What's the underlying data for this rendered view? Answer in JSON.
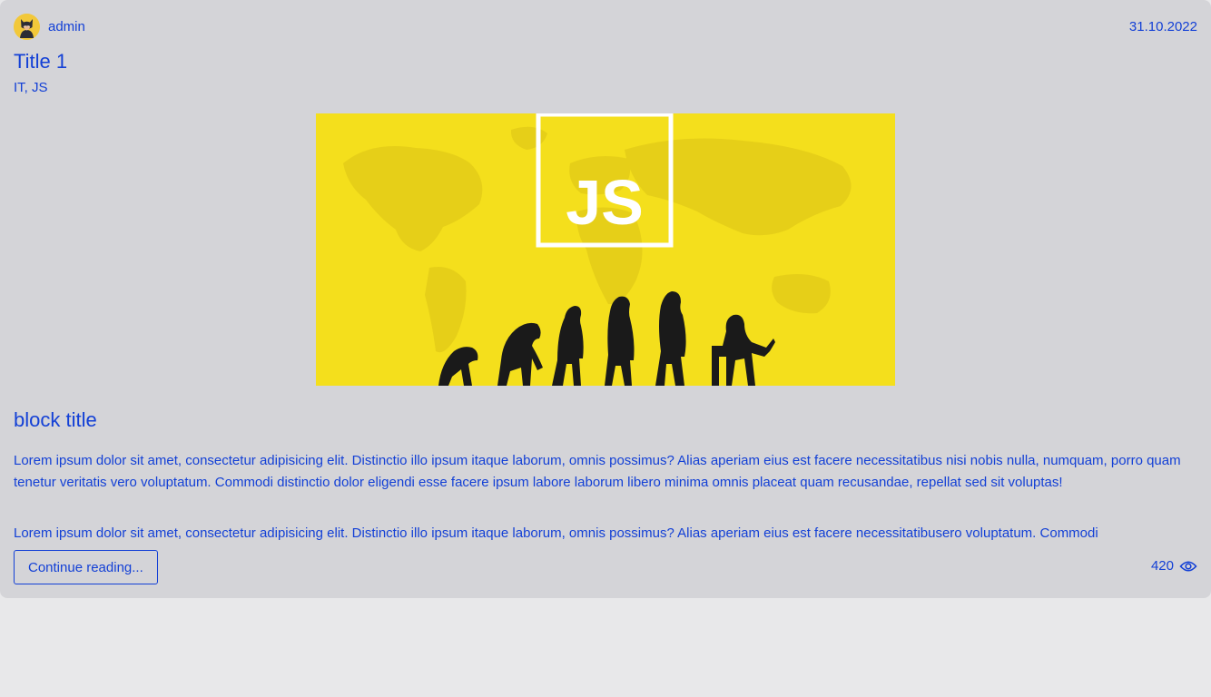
{
  "post": {
    "author": "admin",
    "avatar_icon": "batman-avatar-icon",
    "date": "31.10.2022",
    "title": "Title 1",
    "tags": "IT, JS",
    "image": {
      "logo_text": "JS",
      "theme": "human-evolution-silhouettes-on-world-map",
      "background_color": "#f4df1c"
    },
    "block_title": "block title",
    "paragraphs": [
      "Lorem ipsum dolor sit amet, consectetur adipisicing elit. Distinctio illo ipsum itaque laborum, omnis possimus? Alias aperiam eius est facere necessitatibus nisi nobis nulla, numquam, porro quam tenetur veritatis vero voluptatum. Commodi distinctio dolor eligendi esse facere ipsum labore laborum libero minima omnis placeat quam recusandae, repellat sed sit voluptas!",
      "Lorem ipsum dolor sit amet, consectetur adipisicing elit. Distinctio illo ipsum itaque laborum, omnis possimus? Alias aperiam eius est facere necessitatibusero voluptatum. Commodi"
    ],
    "continue_label": "Continue reading...",
    "views": "420",
    "views_icon": "eye-icon"
  },
  "colors": {
    "link": "#1340d6",
    "card_background": "#d4d4d8",
    "page_background": "#e8e8ea"
  }
}
